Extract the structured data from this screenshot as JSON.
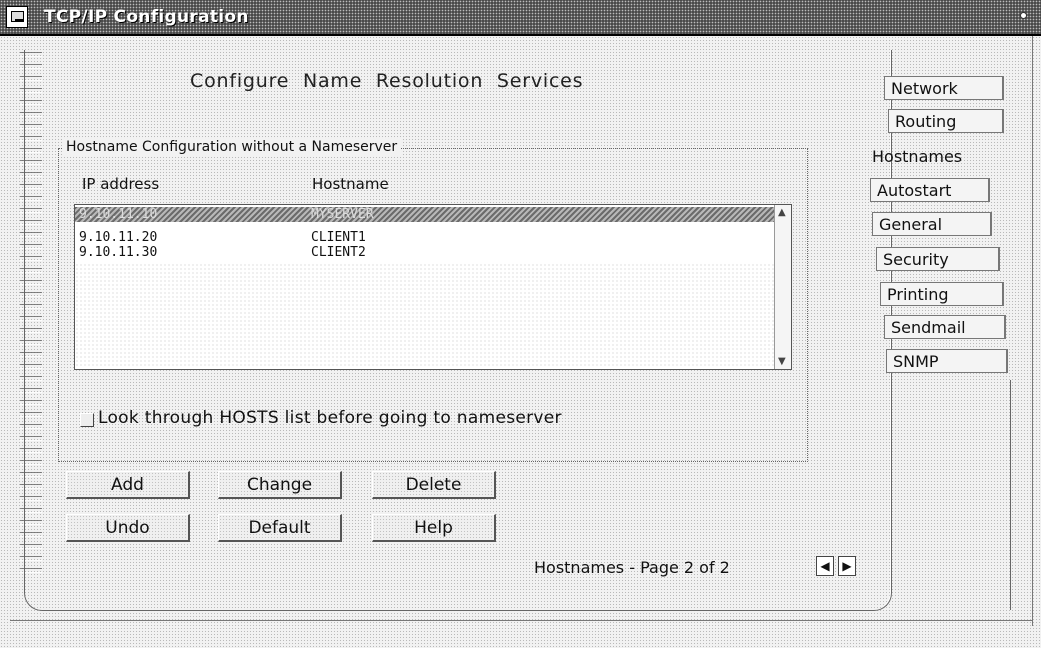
{
  "window": {
    "title": "TCP/IP Configuration"
  },
  "page": {
    "title": "Configure  Name  Resolution  Services"
  },
  "group": {
    "label": "Hostname Configuration without a Nameserver"
  },
  "table": {
    "headers": [
      "IP address",
      "Hostname"
    ],
    "rows": [
      {
        "ip": "9.10.11.10",
        "host": "MYSERVER",
        "selected": true
      },
      {
        "ip": "9.10.11.20",
        "host": "CLIENT1",
        "selected": false
      },
      {
        "ip": "9.10.11.30",
        "host": "CLIENT2",
        "selected": false
      }
    ]
  },
  "checkbox": {
    "label": "Look through HOSTS list before going to nameserver",
    "checked": false
  },
  "buttons": {
    "add": "Add",
    "change": "Change",
    "delete": "Delete",
    "undo": "Undo",
    "default": "Default",
    "help": "Help"
  },
  "pager": {
    "label": "Hostnames - Page 2 of 2"
  },
  "tabs": [
    "Network",
    "Routing",
    "Hostnames",
    "Autostart",
    "General",
    "Security",
    "Printing",
    "Sendmail",
    "SNMP"
  ],
  "active_tab": "Hostnames",
  "icons": {
    "system_menu": "system-menu-icon",
    "prev_page": "arrow-left-icon",
    "next_page": "arrow-right-icon",
    "scroll_up": "arrow-up-icon",
    "scroll_down": "arrow-down-icon"
  }
}
